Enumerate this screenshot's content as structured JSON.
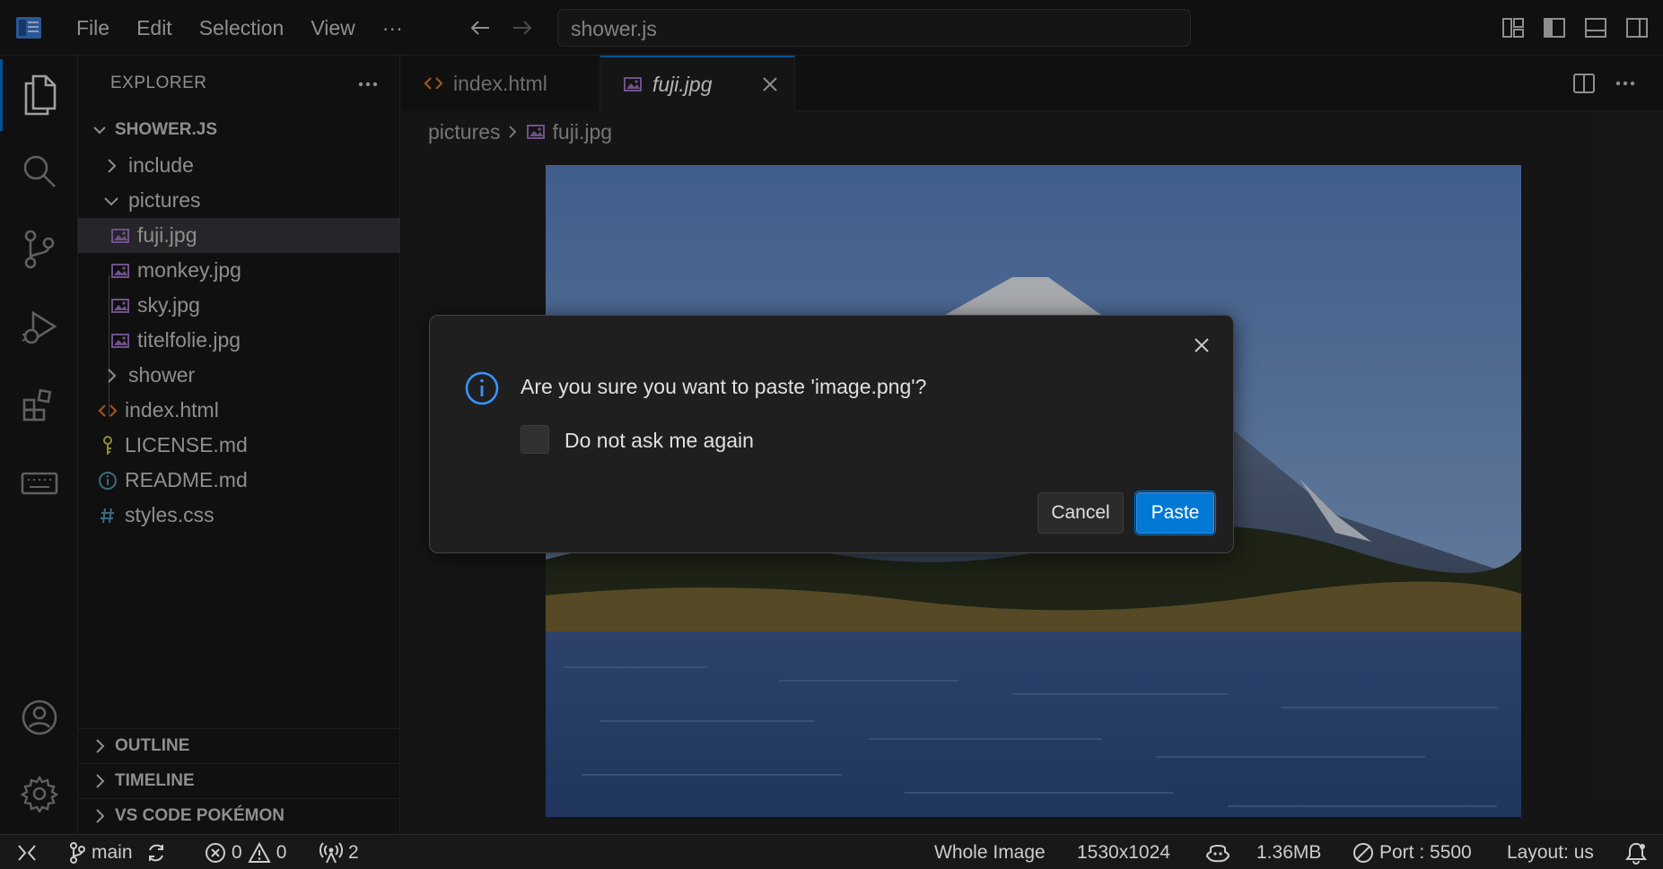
{
  "titlebar": {
    "menu": [
      "File",
      "Edit",
      "Selection",
      "View",
      "···"
    ],
    "command_center": "shower.js"
  },
  "sidebar": {
    "header": "EXPLORER",
    "folder_name": "SHOWER.JS",
    "tree": [
      {
        "label": "include",
        "type": "folder-collapsed"
      },
      {
        "label": "pictures",
        "type": "folder-expanded"
      },
      {
        "label": "fuji.jpg",
        "type": "image",
        "selected": true
      },
      {
        "label": "monkey.jpg",
        "type": "image"
      },
      {
        "label": "sky.jpg",
        "type": "image"
      },
      {
        "label": "titelfolie.jpg",
        "type": "image"
      },
      {
        "label": "shower",
        "type": "folder-collapsed"
      },
      {
        "label": "index.html",
        "type": "html"
      },
      {
        "label": "LICENSE.md",
        "type": "license"
      },
      {
        "label": "README.md",
        "type": "info"
      },
      {
        "label": "styles.css",
        "type": "css"
      }
    ],
    "panels": [
      "OUTLINE",
      "TIMELINE",
      "VS CODE POKÉMON"
    ]
  },
  "editor": {
    "tabs": [
      {
        "label": "index.html",
        "active": false
      },
      {
        "label": "fuji.jpg",
        "active": true
      }
    ],
    "breadcrumb": [
      "pictures",
      "fuji.jpg"
    ]
  },
  "dialog": {
    "message": "Are you sure you want to paste 'image.png'?",
    "checkbox_label": "Do not ask me again",
    "checkbox_checked": false,
    "cancel_label": "Cancel",
    "confirm_label": "Paste"
  },
  "statusbar": {
    "branch": "main",
    "errors": "0",
    "warnings": "0",
    "ports": "2",
    "image_mode": "Whole Image",
    "dimensions": "1530x1024",
    "size": "1.36MB",
    "port": "Port : 5500",
    "layout": "Layout: us"
  },
  "colors": {
    "accent": "#0078d4",
    "image_icon": "#a074c4",
    "html_icon": "#e37933",
    "info_icon": "#519aba"
  }
}
